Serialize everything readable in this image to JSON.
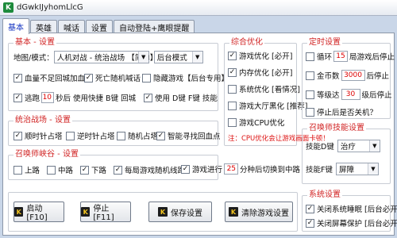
{
  "window": {
    "title": "dGwkIJyhomLlcG",
    "icon_letter": "K"
  },
  "tabs": [
    "基本",
    "英雄",
    "喊话",
    "设置",
    "自动登陆+鹰眼提醒"
  ],
  "basic": {
    "legend": "基本 - 设置",
    "map_label": "地图/模式：",
    "map_value": "人机对战 - 统治战场 【简单】",
    "mode_value": "后台模式",
    "checks": [
      {
        "label": "血量不足回城加血",
        "checked": true
      },
      {
        "label": "死亡随机喊话",
        "checked": true
      },
      {
        "label": "隐藏游戏【后台专用】",
        "checked": false
      }
    ],
    "escape_label": "逃跑",
    "escape_checked": true,
    "escape_seconds": "10",
    "escape_suffix": "秒后 使用快捷 B键 回城",
    "use_check_label": "使用 D键 F键 技能",
    "use_checked": true
  },
  "domination": {
    "legend": "统治战场 - 设置",
    "checks": [
      {
        "label": "顺时针占塔",
        "checked": true
      },
      {
        "label": "逆时针占塔",
        "checked": false
      },
      {
        "label": "随机占塔",
        "checked": false
      },
      {
        "label": "智能寻找回血点",
        "checked": true
      }
    ]
  },
  "canyon": {
    "legend": "召唤师峡谷 - 设置",
    "checks": [
      {
        "label": "上路",
        "checked": false
      },
      {
        "label": "中路",
        "checked": false
      },
      {
        "label": "下路",
        "checked": true
      },
      {
        "label": "每局游戏随机线路",
        "checked": true
      }
    ],
    "progress_label": "游戏进行",
    "progress_checked": true,
    "progress_minutes": "25",
    "progress_suffix": "分种后切换到中路"
  },
  "optimize": {
    "legend": "综合优化",
    "checks": [
      {
        "label": "游戏优化 [必开]",
        "checked": true
      },
      {
        "label": "内存优化 [必开]",
        "checked": true
      },
      {
        "label": "系统优化 [看情况]",
        "checked": false
      },
      {
        "label": "游戏大厅黑化 [推荐]",
        "checked": false
      },
      {
        "label": "游戏CPU优化",
        "checked": false
      }
    ],
    "note": "注：CPU优化会让游戏画面卡顿！"
  },
  "timer": {
    "legend": "定时设置",
    "loop_label": "循环",
    "loop_value": "15",
    "loop_suffix": "局游戏后停止",
    "coin_label": "金币数",
    "coin_value": "3000",
    "coin_suffix": "后停止",
    "level_label": "等级达",
    "level_value": "30",
    "level_suffix": "级后停止",
    "shutdown_label": "停止后是否关机？"
  },
  "summoner": {
    "legend": "召唤师技能设置",
    "d_label": "技能D键",
    "d_value": "治疗",
    "f_label": "技能F键",
    "f_value": "屏障"
  },
  "system": {
    "legend": "系统设置",
    "checks": [
      {
        "label": "关闭系统睡眠 [后台必开]",
        "checked": true
      },
      {
        "label": "关闭屏幕保护 [后台必开]",
        "checked": true
      }
    ]
  },
  "buttons": {
    "start": "启动 [F10]",
    "stop": "停止 [F11]",
    "save": "保存设置",
    "clear": "清除游戏设置"
  },
  "colors": {
    "legend": "#d12424",
    "active_tab": "#1030c0",
    "input_value": "#dd0000"
  }
}
